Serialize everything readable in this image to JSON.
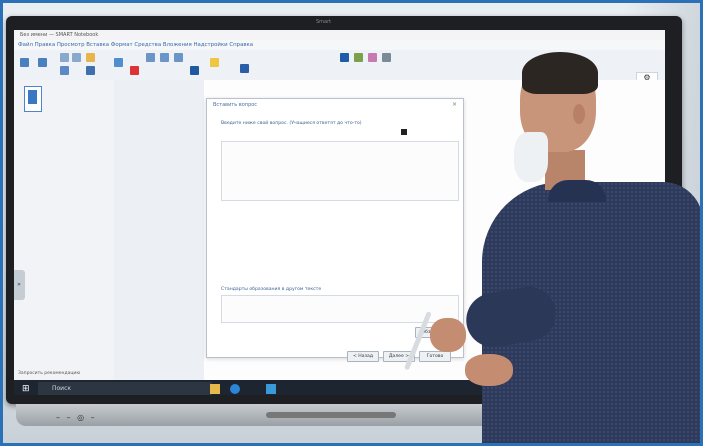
{
  "scene": {
    "display_brand": "Smart",
    "bottom_buttons": "– – ◎ –"
  },
  "app": {
    "title": "Без имени — SMART Notebook",
    "menu": "Файл  Правка  Просмотр  Вставка  Формат  Средства  Вложения  Надстройки  Справка"
  },
  "dialog": {
    "title": "Вставить вопрос",
    "close": "×",
    "prompt": "Введите ниже свой вопрос. (Учащиеся ответят до что-то)",
    "answer_label": "Стандарты образования в другом тексте",
    "browse_button": "Обзор...",
    "back_button": "< Назад",
    "next_button": "Далее >",
    "finish_button": "Готово"
  },
  "right_tools": {
    "settings_icon": "⚙",
    "more_icon": "⇕"
  },
  "side_tab": {
    "label": "»"
  },
  "taskbar": {
    "search_placeholder": "Поиск",
    "status_text": "Запросить рекомендацию"
  },
  "colors": {
    "accent": "#2a71b8",
    "toolbar_blue": "#3a78c4",
    "sweater": "#2d3a5c"
  }
}
